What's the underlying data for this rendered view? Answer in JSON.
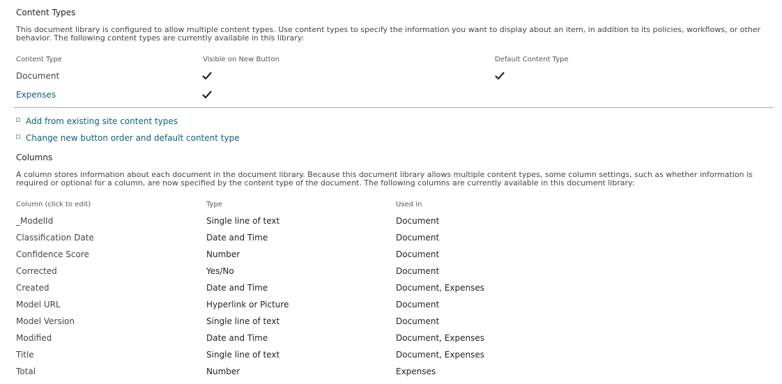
{
  "content_types": {
    "title": "Content Types",
    "description": "This document library is configured to allow multiple content types. Use content types to specify the information you want to display about an item, in addition to its policies, workflows, or other behavior. The following content types are currently available in this library:",
    "headers": {
      "content_type": "Content Type",
      "visible_on_new": "Visible on New Button",
      "default": "Default Content Type"
    },
    "rows": [
      {
        "name": "Document",
        "visible": true,
        "default": true
      },
      {
        "name": "Expenses",
        "visible": true,
        "default": false
      }
    ],
    "links": [
      "Add from existing site content types",
      "Change new button order and default content type"
    ]
  },
  "columns": {
    "title": "Columns",
    "description": "A column stores information about each document in the document library. Because this document library allows multiple content types, some column settings, such as whether information is required or optional for a column, are now specified by the content type of the document. The following columns are currently available in this document library:",
    "headers": {
      "column": "Column (click to edit)",
      "type": "Type",
      "used_in": "Used in"
    },
    "rows": [
      {
        "name": "_ModelId",
        "type": "Single line of text",
        "used_in": "Document"
      },
      {
        "name": "Classification Date",
        "type": "Date and Time",
        "used_in": "Document"
      },
      {
        "name": "Confidence Score",
        "type": "Number",
        "used_in": "Document"
      },
      {
        "name": "Corrected",
        "type": "Yes/No",
        "used_in": "Document"
      },
      {
        "name": "Created",
        "type": "Date and Time",
        "used_in": "Document, Expenses"
      },
      {
        "name": "Model URL",
        "type": "Hyperlink or Picture",
        "used_in": "Document"
      },
      {
        "name": "Model Version",
        "type": "Single line of text",
        "used_in": "Document"
      },
      {
        "name": "Modified",
        "type": "Date and Time",
        "used_in": "Document, Expenses"
      },
      {
        "name": "Title",
        "type": "Single line of text",
        "used_in": "Document, Expenses"
      },
      {
        "name": "Total",
        "type": "Number",
        "used_in": "Expenses"
      }
    ]
  },
  "colors": {
    "link": "#0f6070",
    "text": "#444444",
    "divider": "#a8a8a8"
  },
  "icons": {
    "check": "checkmark-icon",
    "bullet": "square-bullet-icon"
  }
}
